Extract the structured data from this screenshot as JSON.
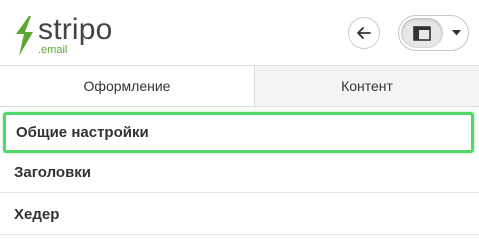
{
  "brand": {
    "wordmark": "stripo",
    "subtext": ".email",
    "accent_color": "#5aa731",
    "icon": "lightning-s-icon"
  },
  "toolbar": {
    "back_icon": "arrow-left-icon",
    "view_icon": "panel-layout-icon",
    "dropdown_icon": "caret-down-icon"
  },
  "tabs": [
    {
      "label": "Оформление",
      "active": true
    },
    {
      "label": "Контент",
      "active": false
    }
  ],
  "sections": [
    {
      "label": "Общие настройки",
      "highlighted": true,
      "highlight_color": "#52d86a"
    },
    {
      "label": "Заголовки",
      "highlighted": false
    },
    {
      "label": "Хедер",
      "highlighted": false
    }
  ]
}
